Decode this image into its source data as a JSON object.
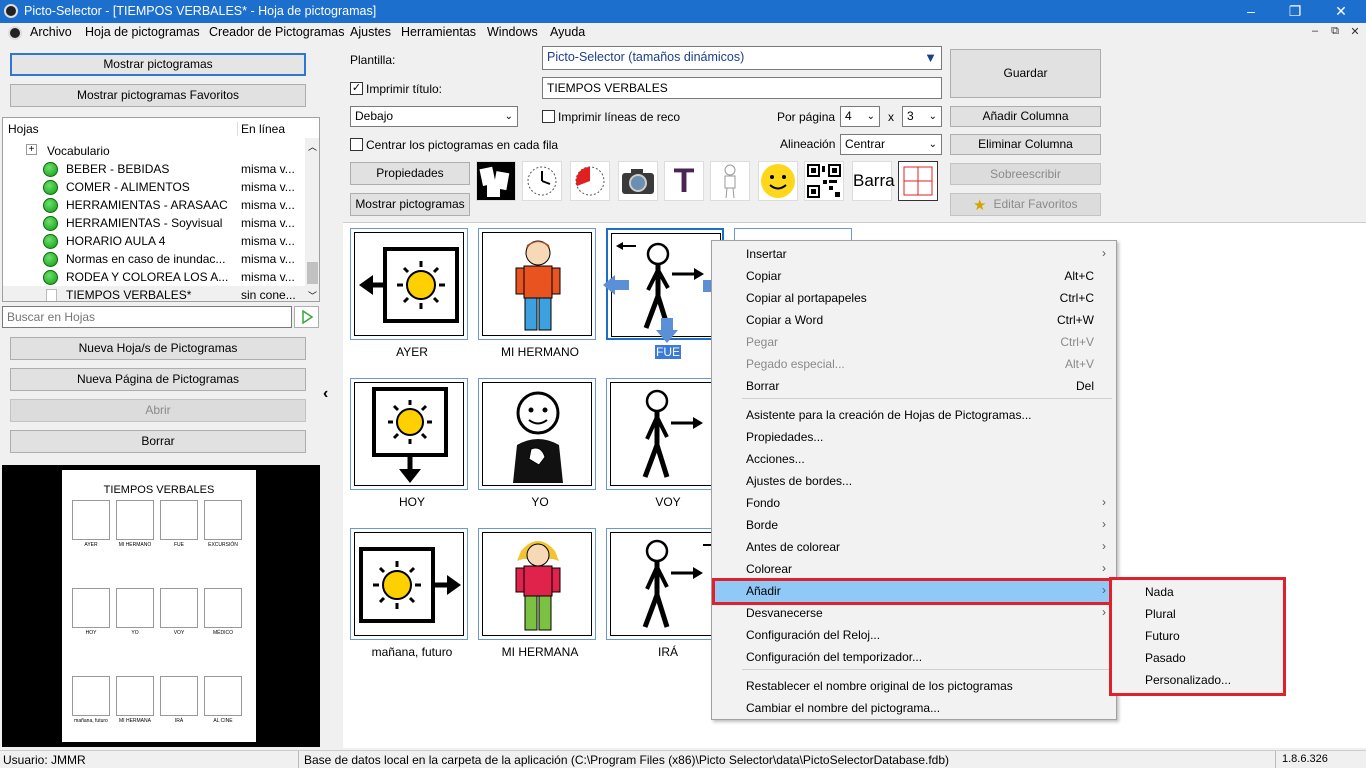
{
  "window": {
    "title": "Picto-Selector - [TIEMPOS VERBALES* - Hoja de pictogramas]",
    "min": "–",
    "restore": "❐",
    "close": "✕"
  },
  "menubar": {
    "items": [
      "Archivo",
      "Hoja de pictogramas",
      "Creador de Pictogramas",
      "Ajustes",
      "Herramientas",
      "Windows",
      "Ayuda"
    ],
    "mdi": [
      "–",
      "⧉",
      "✕"
    ]
  },
  "left": {
    "show_pictos": "Mostrar pictogramas",
    "show_favs": "Mostrar pictogramas Favoritos",
    "tree_headers": [
      "Hojas",
      "En línea"
    ],
    "tree_root": "Vocabulario",
    "sheets": [
      {
        "name": "BEBER - BEBIDAS",
        "online": "misma v..."
      },
      {
        "name": "COMER - ALIMENTOS",
        "online": "misma v..."
      },
      {
        "name": "HERRAMIENTAS - ARASAAC",
        "online": "misma v..."
      },
      {
        "name": "HERRAMIENTAS - Soyvisual",
        "online": "misma v..."
      },
      {
        "name": "HORARIO AULA 4",
        "online": "misma v..."
      },
      {
        "name": "Normas en caso de inundac...",
        "online": "misma v..."
      },
      {
        "name": "RODEA Y COLOREA LOS A...",
        "online": "misma v..."
      },
      {
        "name": "TIEMPOS VERBALES*",
        "online": "sin cone..."
      }
    ],
    "search_placeholder": "Buscar en Hojas",
    "new_sheet": "Nueva Hoja/s de Pictogramas",
    "new_page": "Nueva Página de Pictogramas",
    "open": "Abrir",
    "delete": "Borrar",
    "preview_title": "TIEMPOS VERBALES",
    "preview_labels": [
      "AYER",
      "MI HERMANO",
      "FUE",
      "EXCURSIÓN",
      "HOY",
      "YO",
      "VOY",
      "MÉDICO",
      "mañana, futuro",
      "MI HERMANA",
      "IRÁ",
      "AL CINE"
    ]
  },
  "toolbar": {
    "template_label": "Plantilla:",
    "template_value": "Picto-Selector (tamaños dinámicos)",
    "print_title_label": "Imprimir título:",
    "print_title_checked": "✓",
    "title_value": "TIEMPOS VERBALES",
    "position_value": "Debajo",
    "print_lines_label": "Imprimir líneas de reco",
    "per_page_label": "Por página",
    "cols": "4",
    "x": "x",
    "rows": "3",
    "center_label": "Centrar los pictogramas en cada fila",
    "align_label": "Alineación",
    "align_value": "Centrar",
    "properties": "Propiedades",
    "show_pictos": "Mostrar pictogramas",
    "save": "Guardar",
    "add_col": "Añadir Columna",
    "del_col": "Eliminar Columna",
    "overwrite": "Sobreescribir",
    "edit_favs": "Editar Favoritos",
    "barra": "Barra",
    "text_icon": "T"
  },
  "grid": {
    "labels": [
      "AYER",
      "MI HERMANO",
      "FUE",
      "HOY",
      "YO",
      "VOY",
      "mañana, futuro",
      "MI HERMANA",
      "IRÁ"
    ]
  },
  "context_menu": [
    {
      "label": "Insertar",
      "shortcut": "",
      "arrow": "›",
      "disabled": false
    },
    {
      "label": "Copiar",
      "shortcut": "Alt+C",
      "arrow": "",
      "disabled": false
    },
    {
      "label": "Copiar al portapapeles",
      "shortcut": "Ctrl+C",
      "arrow": "",
      "disabled": false
    },
    {
      "label": "Copiar a Word",
      "shortcut": "Ctrl+W",
      "arrow": "",
      "disabled": false
    },
    {
      "label": "Pegar",
      "shortcut": "Ctrl+V",
      "arrow": "",
      "disabled": true
    },
    {
      "label": "Pegado especial...",
      "shortcut": "Alt+V",
      "arrow": "",
      "disabled": true
    },
    {
      "label": "Borrar",
      "shortcut": "Del",
      "arrow": "",
      "disabled": false
    },
    {
      "label": "Asistente para la creación de Hojas de Pictogramas...",
      "shortcut": "",
      "arrow": "",
      "disabled": false
    },
    {
      "label": "Propiedades...",
      "shortcut": "",
      "arrow": "",
      "disabled": false
    },
    {
      "label": "Acciones...",
      "shortcut": "",
      "arrow": "",
      "disabled": false
    },
    {
      "label": "Ajustes de bordes...",
      "shortcut": "",
      "arrow": "",
      "disabled": false
    },
    {
      "label": "Fondo",
      "shortcut": "",
      "arrow": "›",
      "disabled": false
    },
    {
      "label": "Borde",
      "shortcut": "",
      "arrow": "›",
      "disabled": false
    },
    {
      "label": "Antes de colorear",
      "shortcut": "",
      "arrow": "›",
      "disabled": false
    },
    {
      "label": "Colorear",
      "shortcut": "",
      "arrow": "›",
      "disabled": false
    },
    {
      "label": "Añadir",
      "shortcut": "",
      "arrow": "›",
      "disabled": false
    },
    {
      "label": "Desvanecerse",
      "shortcut": "",
      "arrow": "›",
      "disabled": false
    },
    {
      "label": "Configuración del Reloj...",
      "shortcut": "",
      "arrow": "",
      "disabled": false
    },
    {
      "label": "Configuración del temporizador...",
      "shortcut": "",
      "arrow": "",
      "disabled": false
    },
    {
      "label": "Restablecer el nombre original de los pictogramas",
      "shortcut": "",
      "arrow": "",
      "disabled": false
    },
    {
      "label": "Cambiar el nombre del pictograma...",
      "shortcut": "",
      "arrow": "",
      "disabled": false
    }
  ],
  "submenu": [
    "Nada",
    "Plural",
    "Futuro",
    "Pasado",
    "Personalizado..."
  ],
  "status": {
    "user": "Usuario: JMMR",
    "db": "Base de datos local en la carpeta de la aplicación (C:\\Program Files (x86)\\Picto Selector\\data\\PictoSelectorDatabase.fdb)",
    "version": "1.8.6.326"
  },
  "colors": {
    "titlebar": "#1d6fcd",
    "highlight": "#90c8f6",
    "red_box": "#e0202a"
  }
}
